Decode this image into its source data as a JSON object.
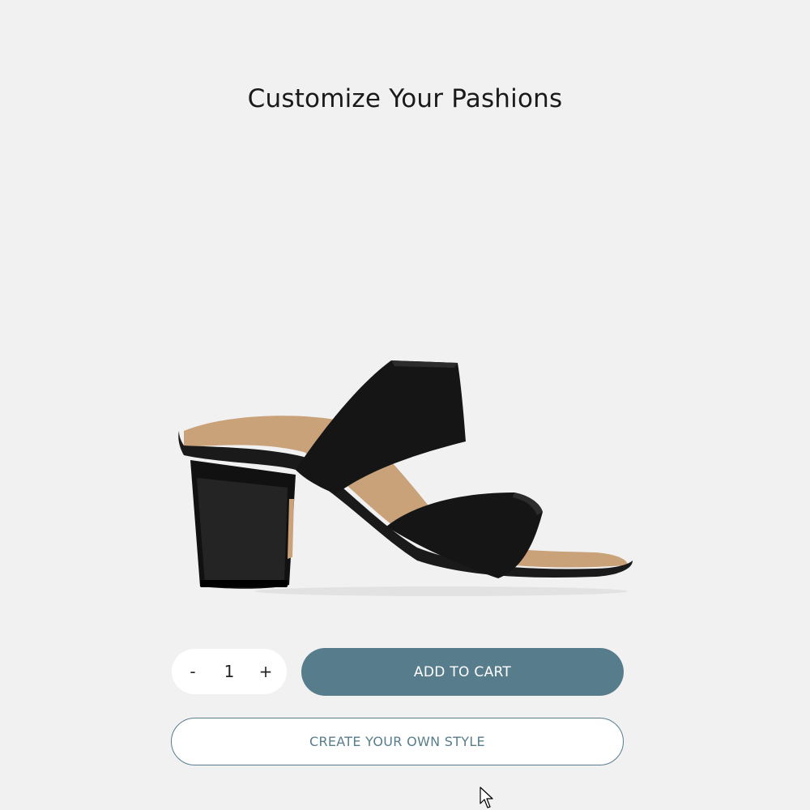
{
  "header": {
    "title": "Customize Your Pashions"
  },
  "product": {
    "image_icon": "black-block-heel-sandal"
  },
  "quantity": {
    "decrement_label": "-",
    "value": "1",
    "increment_label": "+"
  },
  "actions": {
    "add_to_cart_label": "ADD TO CART",
    "create_style_label": "CREATE YOUR OWN STYLE"
  },
  "colors": {
    "background": "#f1f1f1",
    "accent": "#577d8c",
    "surface": "#ffffff"
  }
}
